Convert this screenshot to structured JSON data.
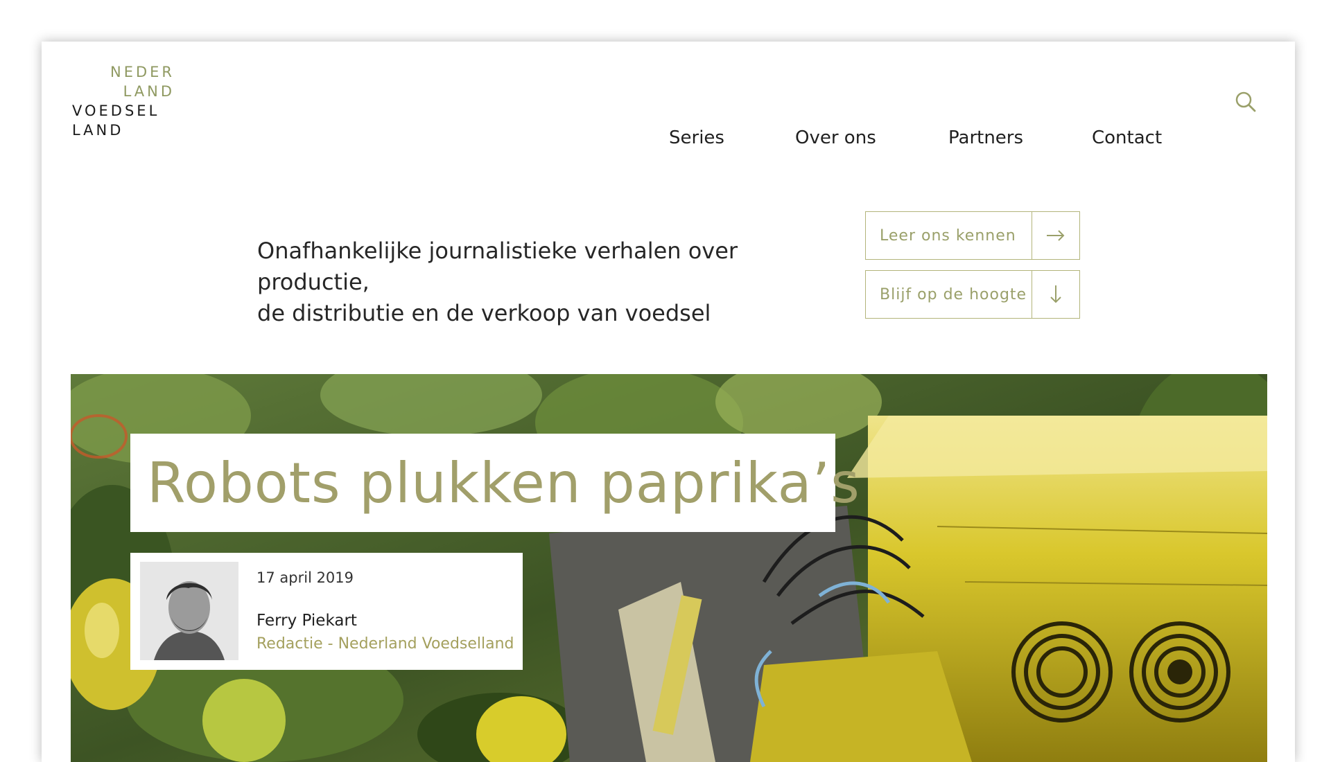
{
  "logo": {
    "line1": "NEDER",
    "line2": "LAND",
    "line3": "VOEDSEL",
    "line4": "LAND"
  },
  "nav": {
    "items": [
      {
        "label": "Series"
      },
      {
        "label": "Over ons"
      },
      {
        "label": "Partners"
      },
      {
        "label": "Contact"
      }
    ],
    "search_icon": "search-icon"
  },
  "intro": {
    "line1": "Onafhankelijke journalistieke verhalen over productie,",
    "line2": "de distributie en de verkoop van voedsel"
  },
  "cta": [
    {
      "label": "Leer ons kennen",
      "icon": "arrow-right-icon"
    },
    {
      "label": "Blijf op de hoogte",
      "icon": "arrow-down-icon"
    }
  ],
  "hero": {
    "title": "Robots plukken paprika’s",
    "date": "17 april 2019",
    "author_name": "Ferry Piekart",
    "author_role": "Redactie - Nederland Voedselland"
  },
  "colors": {
    "accent": "#a19f6a",
    "border": "#b2b47a",
    "text": "#1f1f1f"
  }
}
